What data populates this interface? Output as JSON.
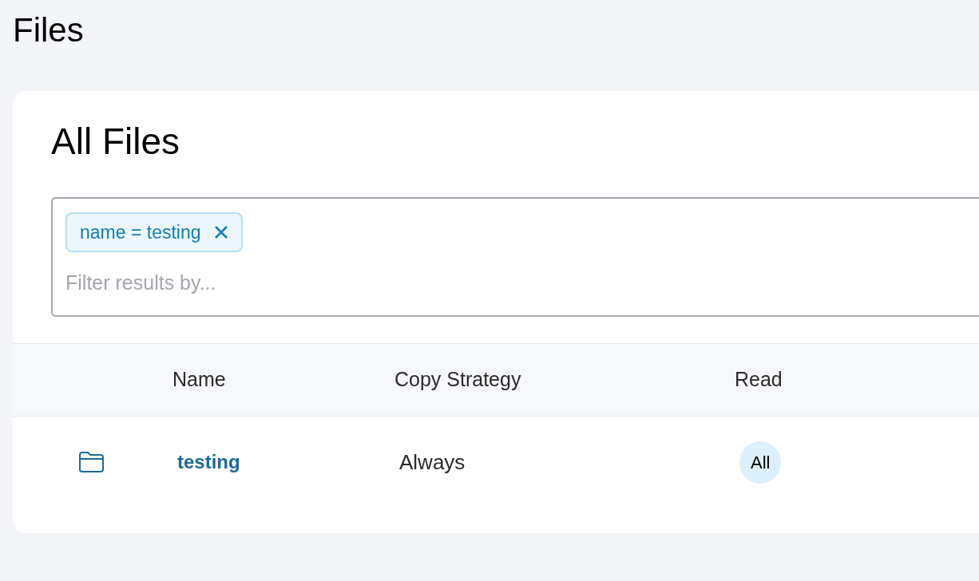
{
  "page": {
    "title": "Files"
  },
  "card": {
    "title": "All Files"
  },
  "filter": {
    "chips": [
      {
        "label": "name = testing"
      }
    ],
    "placeholder": "Filter results by..."
  },
  "table": {
    "columns": [
      "Name",
      "Copy Strategy",
      "Read"
    ],
    "rows": [
      {
        "kind": "folder",
        "name": "testing",
        "copy_strategy": "Always",
        "read": "All"
      }
    ]
  }
}
